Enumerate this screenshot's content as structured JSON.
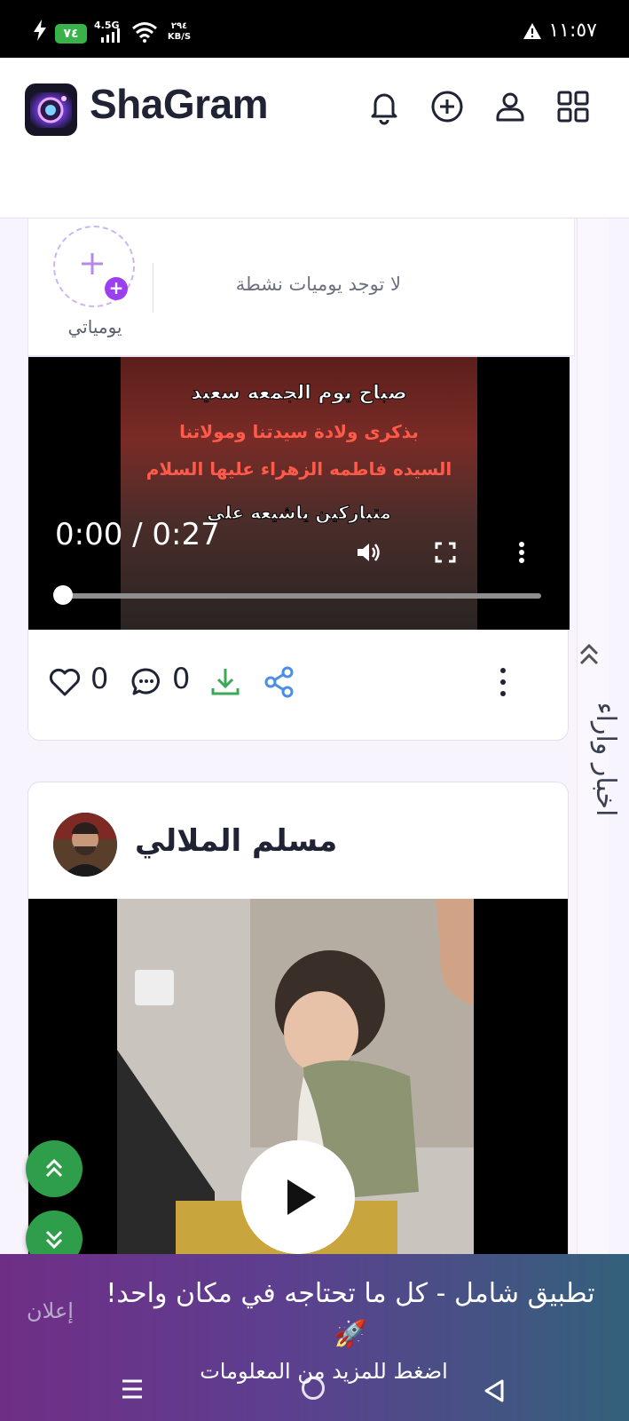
{
  "status_bar": {
    "battery": "٧٤",
    "network": "4.5G",
    "speed_value": "٢٩٤",
    "speed_unit": "KB/S",
    "time": "١١:٥٧"
  },
  "header": {
    "brand": "ShaGram",
    "icons": [
      "bell-icon",
      "plus-circle-icon",
      "user-icon",
      "grid-icon"
    ]
  },
  "stories": {
    "my_story_label": "يومياتي",
    "empty_text": "لا توجد يوميات نشطة"
  },
  "side_panel": {
    "label": "اخبار واراء"
  },
  "post1": {
    "video_lines": [
      "صباح يوم الجمعه سعيد",
      "بذكرى ولادة سيدتنا ومولاتنا",
      "السيده فاطمه الزهراء عليها السلام",
      "متباركين ياشيعه علي"
    ],
    "time_display": "0:00 / 0:27",
    "progress": 0,
    "likes": "0",
    "comments": "0"
  },
  "post2": {
    "author": "مسلم الملالي"
  },
  "ad": {
    "label": "إعلان",
    "text": "تطبيق شامل - كل ما تحتاجه في مكان واحد! 🚀",
    "cta": "اضغط للمزيد من المعلومات"
  },
  "colors": {
    "accent": "#9b3ff0",
    "fab_green": "#2f9e4a",
    "download_green": "#3aaa57",
    "share_blue": "#4a8ee8"
  }
}
